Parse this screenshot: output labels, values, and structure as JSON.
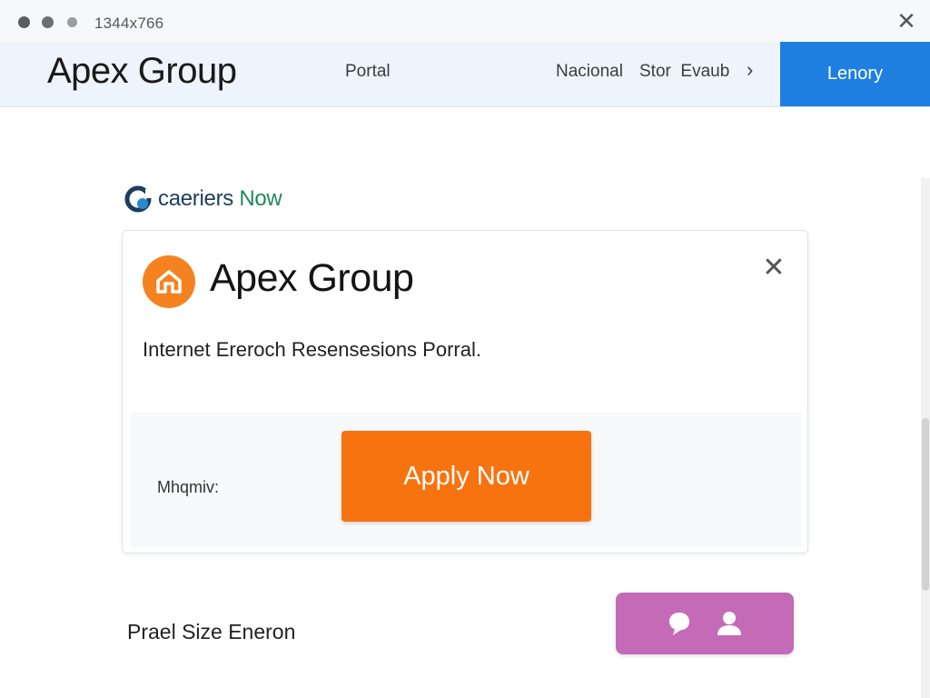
{
  "window": {
    "title": "1344x766",
    "close_glyph": "✕"
  },
  "navbar": {
    "brand": "Apex Group",
    "links": [
      "Portal",
      "Nacional",
      "Stor",
      "Evaub"
    ],
    "chevron_glyph": "›",
    "cta_label": "Lenory",
    "cta_color": "#1f7fe0"
  },
  "careers": {
    "text_main": "caeriers ",
    "text_accent": "Now",
    "icon": "careers-logo-icon"
  },
  "card": {
    "logo_icon": "home-icon",
    "logo_color": "#f58220",
    "title": "Apex Group",
    "close_glyph": "✕",
    "description": "Internet Ereroch Resensesions Porral.",
    "footer_label": "Mhqmiv:",
    "apply_label": "Apply Now",
    "apply_color": "#f7730f"
  },
  "bottom": {
    "label": "Prael Size Eneron",
    "chat_button_color": "#c46ab7",
    "chat_icons": [
      "chat-bubble-icon",
      "user-icon"
    ]
  }
}
